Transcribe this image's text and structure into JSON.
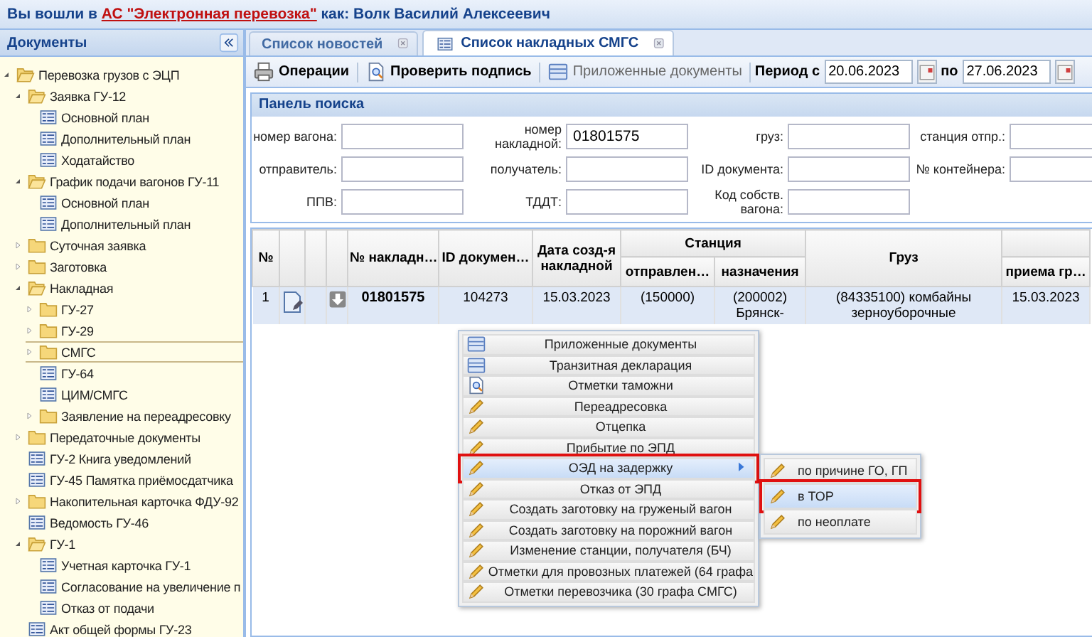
{
  "top_bar": {
    "text_before": "Вы вошли в",
    "link": "АС \"Электронная перевозка\"",
    "text_after": "как: Волк Василий Алексеевич"
  },
  "sidebar": {
    "title": "Документы",
    "items": [
      {
        "kind": "folder",
        "label": "Перевозка грузов с ЭЦП",
        "expanded": true,
        "selected": false,
        "children": [
          {
            "kind": "folder",
            "label": "Заявка ГУ-12",
            "expanded": true,
            "selected": false,
            "children": [
              {
                "kind": "doc",
                "label": "Основной план",
                "selected": false
              },
              {
                "kind": "doc",
                "label": "Дополнительный план",
                "selected": false
              },
              {
                "kind": "doc",
                "label": "Ходатайство",
                "selected": false
              }
            ]
          },
          {
            "kind": "folder",
            "label": "График подачи вагонов ГУ-11",
            "expanded": true,
            "selected": false,
            "children": [
              {
                "kind": "doc",
                "label": "Основной план",
                "selected": false
              },
              {
                "kind": "doc",
                "label": "Дополнительный план",
                "selected": false
              }
            ]
          },
          {
            "kind": "folder",
            "label": "Суточная заявка",
            "expanded": false,
            "selected": false
          },
          {
            "kind": "folder",
            "label": "Заготовка",
            "expanded": false,
            "selected": false
          },
          {
            "kind": "folder",
            "label": "Накладная",
            "expanded": true,
            "selected": false,
            "children": [
              {
                "kind": "folder",
                "label": "ГУ-27",
                "expanded": false,
                "selected": false
              },
              {
                "kind": "folder",
                "label": "ГУ-29",
                "expanded": false,
                "selected": false
              },
              {
                "kind": "folder",
                "label": "СМГС",
                "expanded": false,
                "selected": true
              },
              {
                "kind": "doc",
                "label": "ГУ-64",
                "selected": false
              },
              {
                "kind": "doc",
                "label": "ЦИМ/СМГС",
                "selected": false
              },
              {
                "kind": "folder",
                "label": "Заявление на переадресовку",
                "expanded": false,
                "selected": false
              }
            ]
          },
          {
            "kind": "folder",
            "label": "Передаточные документы",
            "expanded": false,
            "selected": false
          },
          {
            "kind": "doc",
            "label": "ГУ-2 Книга уведомлений",
            "selected": false
          },
          {
            "kind": "doc",
            "label": "ГУ-45 Памятка приёмосдатчика",
            "selected": false
          },
          {
            "kind": "folder",
            "label": "Накопительная карточка ФДУ-92",
            "expanded": false,
            "selected": false
          },
          {
            "kind": "doc",
            "label": "Ведомость ГУ-46",
            "selected": false
          },
          {
            "kind": "folder",
            "label": "ГУ-1",
            "expanded": true,
            "selected": false,
            "children": [
              {
                "kind": "doc",
                "label": "Учетная карточка ГУ-1",
                "selected": false
              },
              {
                "kind": "doc",
                "label": "Согласование на увеличение п",
                "selected": false
              },
              {
                "kind": "doc",
                "label": "Отказ от подачи",
                "selected": false
              }
            ]
          },
          {
            "kind": "doc",
            "label": "Акт общей формы ГУ-23",
            "selected": false
          }
        ]
      }
    ]
  },
  "tabs": [
    {
      "label": "Список новостей",
      "selected": false
    },
    {
      "label": "Список накладных СМГС",
      "selected": true
    }
  ],
  "toolbar": {
    "buttons": [
      {
        "label": "Операции",
        "disabled": false
      },
      {
        "label": "Проверить подпись",
        "disabled": false
      },
      {
        "label": "Приложенные документы",
        "disabled": true
      }
    ],
    "period_from_label": "Период с",
    "date_from": "20.06.2023",
    "period_to_label": "по",
    "date_to": "27.06.2023"
  },
  "search_panel": {
    "title": "Панель поиска",
    "fields": [
      {
        "label": "номер вагона:"
      },
      {
        "label": "номер накладной:",
        "value": "01801575"
      },
      {
        "label": "груз:"
      },
      {
        "label": "станция отпр.:"
      },
      {
        "label": "отправитель:"
      },
      {
        "label": "получатель:"
      },
      {
        "label": "ID документа:"
      },
      {
        "label": "№ контейнера:"
      },
      {
        "label": "ППВ:"
      },
      {
        "label": "ТДДТ:"
      },
      {
        "label": "Код собств. вагона:"
      }
    ]
  },
  "table": {
    "columns": [
      {
        "kind": "text",
        "label": "№"
      },
      {
        "kind": "icon"
      },
      {
        "kind": "icon"
      },
      {
        "kind": "icon"
      },
      {
        "kind": "text",
        "label": "№ накладн…"
      },
      {
        "kind": "text",
        "label": "ID докумен…"
      },
      {
        "kind": "text",
        "label": "Дата созд-я накладной"
      },
      {
        "kind": "group",
        "label": "Станция",
        "colspan": 2,
        "children": [
          {
            "label": "отправлен…"
          },
          {
            "label": "назначения"
          }
        ]
      },
      {
        "kind": "text",
        "label": "Груз"
      },
      {
        "kind": "group",
        "children": [
          {
            "label": "приема гр…"
          }
        ]
      }
    ],
    "rows": [
      {
        "selected": true,
        "cells": [
          "1",
          "",
          "",
          "",
          "01801575",
          "104273",
          "15.03.2023",
          "(150000)",
          "(200002) Брянск-",
          "(84335100) комбайны зерноуборочные",
          "15.03.2023"
        ]
      }
    ]
  },
  "context_menu": {
    "items": [
      {
        "label": "Приложенные документы",
        "selected": false
      },
      {
        "label": "Транзитная декларация",
        "selected": false
      },
      {
        "label": "Отметки таможни",
        "selected": false
      },
      {
        "label": "Переадресовка",
        "selected": false
      },
      {
        "label": "Отцепка",
        "selected": false
      },
      {
        "label": "Прибытие по ЭПД",
        "selected": false
      },
      {
        "label": "ОЭД на задержку",
        "selected": true,
        "submenu": [
          {
            "label": "по причине ГО, ГП",
            "selected": false
          },
          {
            "label": "в ТОР",
            "selected": true
          },
          {
            "label": "по неоплате",
            "selected": false
          }
        ]
      },
      {
        "label": "Отказ от ЭПД",
        "selected": false
      },
      {
        "label": "Создать заготовку на груженый вагон",
        "selected": false
      },
      {
        "label": "Создать заготовку на порожний вагон",
        "selected": false
      },
      {
        "label": "Изменение станции, получателя (БЧ)",
        "selected": false
      },
      {
        "label": "Отметки для провозных платежей (64 графа",
        "selected": false
      },
      {
        "label": "Отметки перевозчика (30 графа СМГС)",
        "selected": false
      }
    ]
  }
}
